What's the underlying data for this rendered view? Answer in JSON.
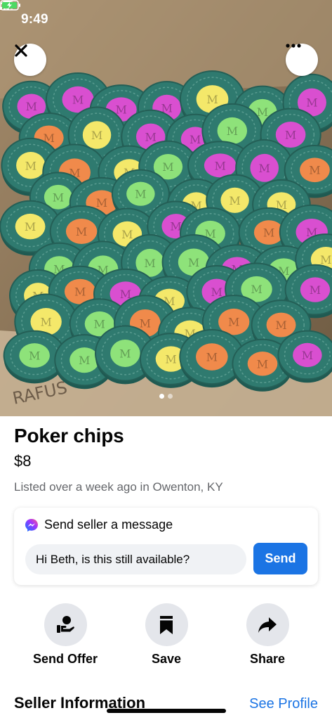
{
  "status_bar": {
    "time": "9:49",
    "location_icon": "location-arrow-icon",
    "signal_icon": "cellular-signal-icon",
    "wifi_icon": "wifi-icon",
    "battery_icon": "battery-charging-icon"
  },
  "photo": {
    "close_icon": "close-icon",
    "more_icon": "more-horizontal-icon",
    "image_count": 2,
    "active_image_index": 1
  },
  "listing": {
    "title": "Poker chips",
    "price": "$8",
    "listed": "Listed over a week ago in Owenton, KY"
  },
  "message": {
    "heading": "Send seller a message",
    "icon": "messenger-icon",
    "input_value": "Hi Beth, is this still available?",
    "send_label": "Send"
  },
  "actions": [
    {
      "label": "Send Offer",
      "icon": "offer-hand-icon"
    },
    {
      "label": "Save",
      "icon": "bookmark-icon"
    },
    {
      "label": "Share",
      "icon": "share-arrow-icon"
    }
  ],
  "seller": {
    "title": "Seller Information",
    "see_profile": "See Profile"
  },
  "colors": {
    "accent": "#1b74e4",
    "chip_body": "#2f7a6f",
    "chip_centers": [
      "#f4e86a",
      "#d94fd0",
      "#8ee27a",
      "#f08a4b"
    ]
  }
}
